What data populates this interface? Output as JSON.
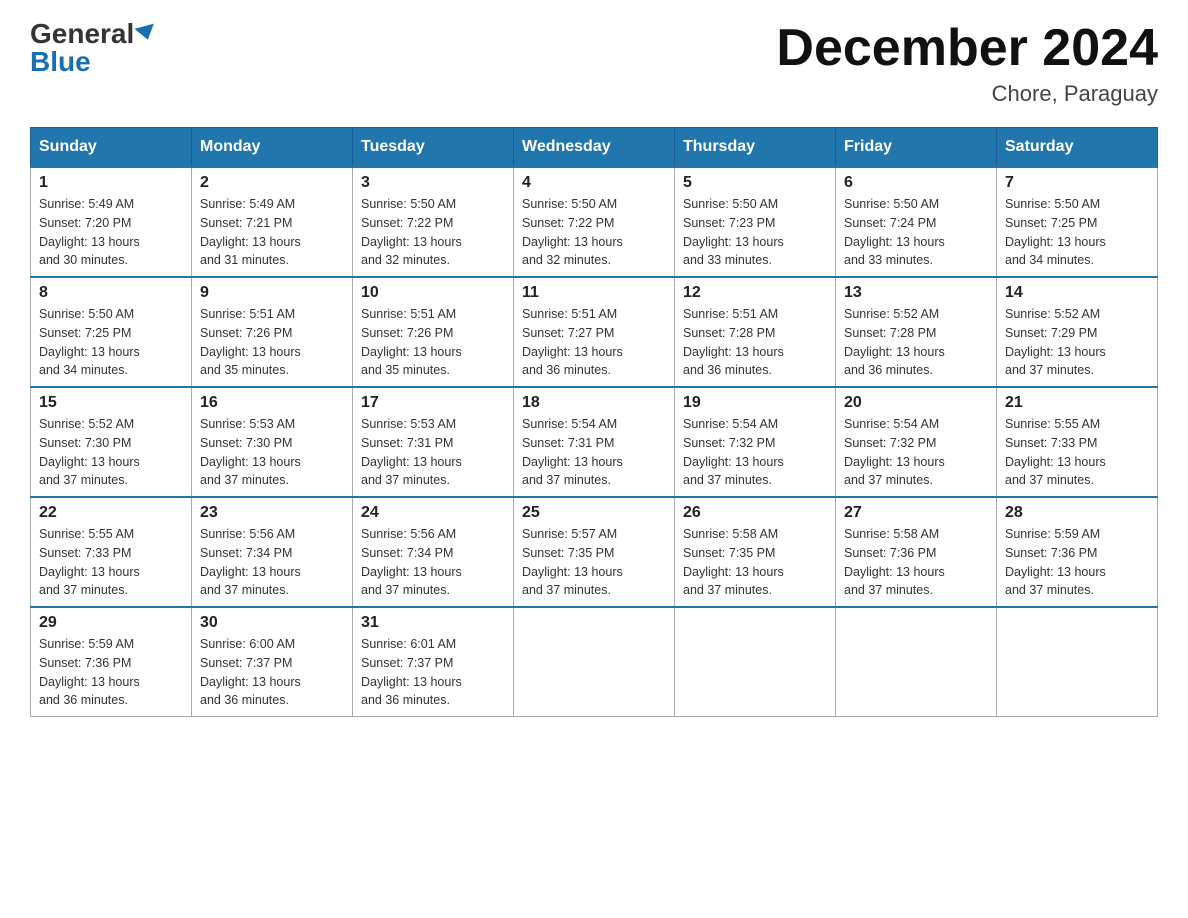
{
  "header": {
    "logo_general": "General",
    "logo_blue": "Blue",
    "month_title": "December 2024",
    "location": "Chore, Paraguay"
  },
  "days_of_week": [
    "Sunday",
    "Monday",
    "Tuesday",
    "Wednesday",
    "Thursday",
    "Friday",
    "Saturday"
  ],
  "weeks": [
    [
      {
        "day": "1",
        "sunrise": "5:49 AM",
        "sunset": "7:20 PM",
        "daylight": "13 hours and 30 minutes."
      },
      {
        "day": "2",
        "sunrise": "5:49 AM",
        "sunset": "7:21 PM",
        "daylight": "13 hours and 31 minutes."
      },
      {
        "day": "3",
        "sunrise": "5:50 AM",
        "sunset": "7:22 PM",
        "daylight": "13 hours and 32 minutes."
      },
      {
        "day": "4",
        "sunrise": "5:50 AM",
        "sunset": "7:22 PM",
        "daylight": "13 hours and 32 minutes."
      },
      {
        "day": "5",
        "sunrise": "5:50 AM",
        "sunset": "7:23 PM",
        "daylight": "13 hours and 33 minutes."
      },
      {
        "day": "6",
        "sunrise": "5:50 AM",
        "sunset": "7:24 PM",
        "daylight": "13 hours and 33 minutes."
      },
      {
        "day": "7",
        "sunrise": "5:50 AM",
        "sunset": "7:25 PM",
        "daylight": "13 hours and 34 minutes."
      }
    ],
    [
      {
        "day": "8",
        "sunrise": "5:50 AM",
        "sunset": "7:25 PM",
        "daylight": "13 hours and 34 minutes."
      },
      {
        "day": "9",
        "sunrise": "5:51 AM",
        "sunset": "7:26 PM",
        "daylight": "13 hours and 35 minutes."
      },
      {
        "day": "10",
        "sunrise": "5:51 AM",
        "sunset": "7:26 PM",
        "daylight": "13 hours and 35 minutes."
      },
      {
        "day": "11",
        "sunrise": "5:51 AM",
        "sunset": "7:27 PM",
        "daylight": "13 hours and 36 minutes."
      },
      {
        "day": "12",
        "sunrise": "5:51 AM",
        "sunset": "7:28 PM",
        "daylight": "13 hours and 36 minutes."
      },
      {
        "day": "13",
        "sunrise": "5:52 AM",
        "sunset": "7:28 PM",
        "daylight": "13 hours and 36 minutes."
      },
      {
        "day": "14",
        "sunrise": "5:52 AM",
        "sunset": "7:29 PM",
        "daylight": "13 hours and 37 minutes."
      }
    ],
    [
      {
        "day": "15",
        "sunrise": "5:52 AM",
        "sunset": "7:30 PM",
        "daylight": "13 hours and 37 minutes."
      },
      {
        "day": "16",
        "sunrise": "5:53 AM",
        "sunset": "7:30 PM",
        "daylight": "13 hours and 37 minutes."
      },
      {
        "day": "17",
        "sunrise": "5:53 AM",
        "sunset": "7:31 PM",
        "daylight": "13 hours and 37 minutes."
      },
      {
        "day": "18",
        "sunrise": "5:54 AM",
        "sunset": "7:31 PM",
        "daylight": "13 hours and 37 minutes."
      },
      {
        "day": "19",
        "sunrise": "5:54 AM",
        "sunset": "7:32 PM",
        "daylight": "13 hours and 37 minutes."
      },
      {
        "day": "20",
        "sunrise": "5:54 AM",
        "sunset": "7:32 PM",
        "daylight": "13 hours and 37 minutes."
      },
      {
        "day": "21",
        "sunrise": "5:55 AM",
        "sunset": "7:33 PM",
        "daylight": "13 hours and 37 minutes."
      }
    ],
    [
      {
        "day": "22",
        "sunrise": "5:55 AM",
        "sunset": "7:33 PM",
        "daylight": "13 hours and 37 minutes."
      },
      {
        "day": "23",
        "sunrise": "5:56 AM",
        "sunset": "7:34 PM",
        "daylight": "13 hours and 37 minutes."
      },
      {
        "day": "24",
        "sunrise": "5:56 AM",
        "sunset": "7:34 PM",
        "daylight": "13 hours and 37 minutes."
      },
      {
        "day": "25",
        "sunrise": "5:57 AM",
        "sunset": "7:35 PM",
        "daylight": "13 hours and 37 minutes."
      },
      {
        "day": "26",
        "sunrise": "5:58 AM",
        "sunset": "7:35 PM",
        "daylight": "13 hours and 37 minutes."
      },
      {
        "day": "27",
        "sunrise": "5:58 AM",
        "sunset": "7:36 PM",
        "daylight": "13 hours and 37 minutes."
      },
      {
        "day": "28",
        "sunrise": "5:59 AM",
        "sunset": "7:36 PM",
        "daylight": "13 hours and 37 minutes."
      }
    ],
    [
      {
        "day": "29",
        "sunrise": "5:59 AM",
        "sunset": "7:36 PM",
        "daylight": "13 hours and 36 minutes."
      },
      {
        "day": "30",
        "sunrise": "6:00 AM",
        "sunset": "7:37 PM",
        "daylight": "13 hours and 36 minutes."
      },
      {
        "day": "31",
        "sunrise": "6:01 AM",
        "sunset": "7:37 PM",
        "daylight": "13 hours and 36 minutes."
      },
      null,
      null,
      null,
      null
    ]
  ],
  "labels": {
    "sunrise": "Sunrise:",
    "sunset": "Sunset:",
    "daylight": "Daylight:"
  }
}
